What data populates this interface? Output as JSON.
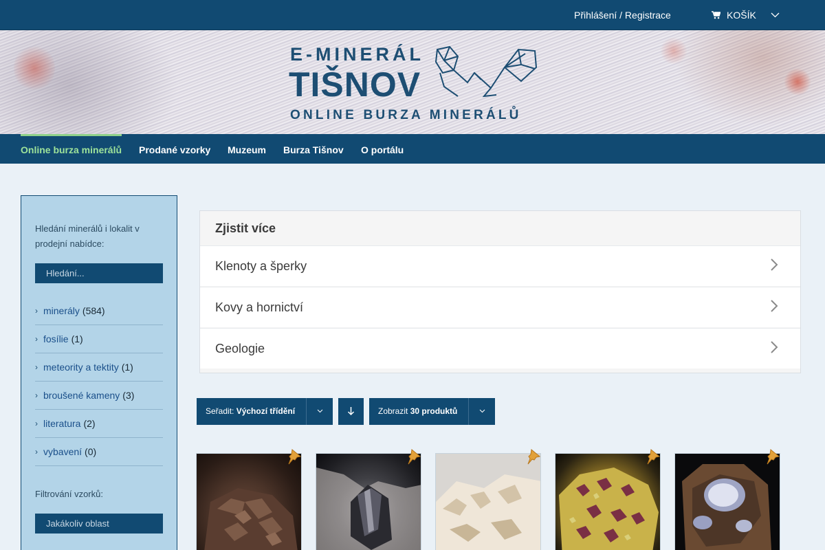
{
  "topbar": {
    "login_label": "Přihlášení / Registrace",
    "cart_label": "KOŠÍK",
    "cart_icon": "cart-icon",
    "background": "#114a72"
  },
  "banner": {
    "logo_top": "E-MINERÁL",
    "logo_main": "TIŠNOV",
    "logo_sub": "ONLINE BURZA MINERÁLŮ"
  },
  "nav": {
    "items": [
      {
        "label": "Online burza minerálů",
        "active": true
      },
      {
        "label": "Prodané vzorky"
      },
      {
        "label": "Muzeum"
      },
      {
        "label": "Burza Tišnov"
      },
      {
        "label": "O portálu"
      }
    ],
    "active_color": "#9ee39a"
  },
  "sidebar": {
    "search_label": "Hledání minerálů i lokalit v prodejní nabídce:",
    "search_placeholder": "Hledání...",
    "categories": [
      {
        "name": "minerály",
        "count": "(584)"
      },
      {
        "name": "fosílie",
        "count": "(1)"
      },
      {
        "name": "meteority a tektity",
        "count": "(1)"
      },
      {
        "name": "broušené kameny",
        "count": "(3)"
      },
      {
        "name": "literatura",
        "count": "(2)"
      },
      {
        "name": "vybavení",
        "count": "(0)"
      }
    ],
    "filter_label": "Filtrování vzorků:",
    "filter_placeholder": "Jakákoliv oblast"
  },
  "accordion": {
    "title": "Zjistit více",
    "items": [
      {
        "label": "Klenoty a šperky"
      },
      {
        "label": "Kovy a hornictví"
      },
      {
        "label": "Geologie"
      }
    ]
  },
  "toolbar": {
    "sort_prefix": "Seřadit:",
    "sort_value": "Výchozí třídění",
    "show_prefix": "Zobrazit",
    "show_value": "30 produktů"
  },
  "products": [
    {
      "name": "product-1",
      "palette": "dark-brown-crystals"
    },
    {
      "name": "product-2",
      "palette": "black-crystal-on-white"
    },
    {
      "name": "product-3",
      "palette": "white-crust"
    },
    {
      "name": "product-4",
      "palette": "purple-yellow-crystals"
    },
    {
      "name": "product-5",
      "palette": "agate-nodule"
    }
  ],
  "colors": {
    "primary": "#114a72",
    "sidebar_bg": "#b3d4e8",
    "pin": "#e2a13a"
  }
}
